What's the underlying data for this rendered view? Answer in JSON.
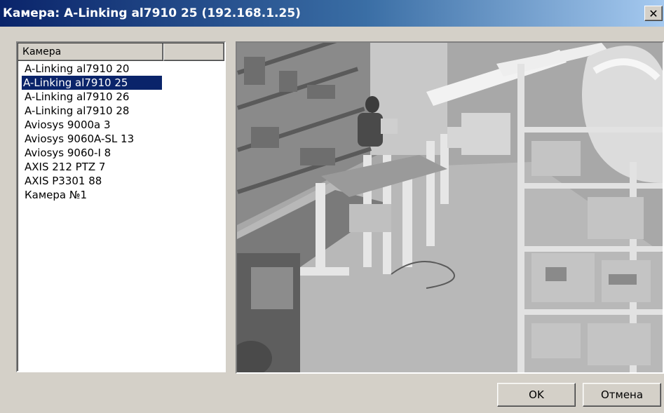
{
  "window": {
    "title": "Камера: A-Linking al7910 25 (192.168.1.25)",
    "close_glyph": "✕"
  },
  "camera_list": {
    "columns": [
      "Камера",
      ""
    ],
    "items": [
      "A-Linking al7910 20",
      "A-Linking al7910 25",
      "A-Linking al7910 26",
      "A-Linking al7910 28",
      "Aviosys 9000a 3",
      "Aviosys 9060A-SL 13",
      "Aviosys 9060-I 8",
      "AXIS 212 PTZ 7",
      "AXIS P3301 88",
      "Камера №1"
    ],
    "selected_index": 1
  },
  "preview": {
    "icon": "camera-feed-image",
    "description_colors": {
      "dark": "#3c3c3c",
      "mid": "#9a9a9a",
      "light": "#e8e8e8"
    }
  },
  "buttons": {
    "ok_label": "OK",
    "cancel_label": "Отмена"
  },
  "colors": {
    "title_start": "#0a246a",
    "title_end": "#a6caf0",
    "selection": "#0a246a",
    "face": "#d4d0c8"
  }
}
